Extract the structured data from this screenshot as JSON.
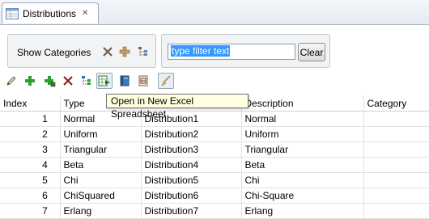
{
  "tab": {
    "title": "Distributions",
    "close": "✕"
  },
  "categories": {
    "label": "Show Categories"
  },
  "filter": {
    "value": "type filter text",
    "clear_label": "Clear"
  },
  "tooltip": {
    "text": "Open in New Excel Spreadsheet"
  },
  "table": {
    "columns": [
      "Index",
      "Type",
      "Name",
      "Description",
      "Category"
    ],
    "rows": [
      [
        "1",
        "Normal",
        "Distribution1",
        "Normal",
        ""
      ],
      [
        "2",
        "Uniform",
        "Distribution2",
        "Uniform",
        ""
      ],
      [
        "3",
        "Triangular",
        "Distribution3",
        "Triangular",
        ""
      ],
      [
        "4",
        "Beta",
        "Distribution4",
        "Beta",
        ""
      ],
      [
        "5",
        "Chi",
        "Distribution5",
        "Chi",
        ""
      ],
      [
        "6",
        "ChiSquared",
        "Distribution6",
        "Chi-Square",
        ""
      ],
      [
        "7",
        "Erlang",
        "Distribution7",
        "Erlang",
        ""
      ]
    ]
  },
  "colors": {
    "accent": "#3399ff",
    "tooltip_bg": "#ffffe1",
    "add": "#2e9e2e",
    "delete": "#8a1a1a"
  },
  "icons": [
    "distributions-tab-icon",
    "collapse-all-icon",
    "add-category-icon",
    "tree-icon",
    "edit-icon",
    "add-icon",
    "add-to-category-icon",
    "delete-icon",
    "show-hierarchy-icon",
    "excel-icon",
    "book-icon",
    "report-icon",
    "brush-icon"
  ]
}
